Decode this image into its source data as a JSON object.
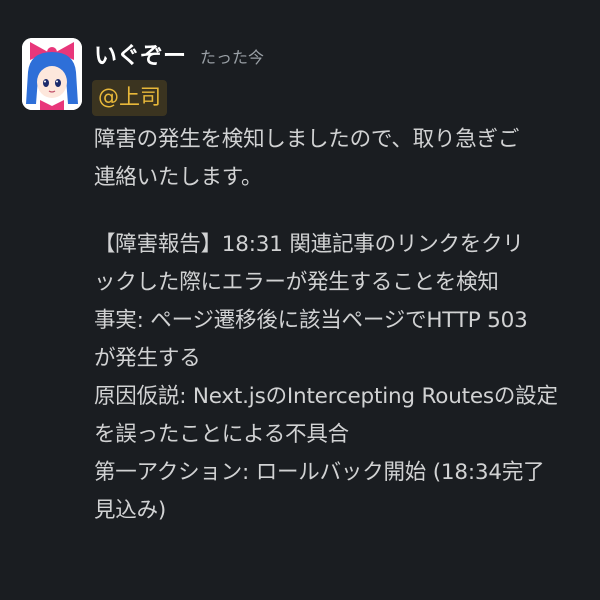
{
  "message": {
    "author": "いぐぞー",
    "timestamp": "たった今",
    "mention": "@上司",
    "intro_lines": [
      "障害の発生を検知しましたので、取り急ぎご",
      "連絡いたします。"
    ],
    "report_lines": [
      "【障害報告】18:31  関連記事のリンクをクリ",
      "ックした際にエラーが発生することを検知",
      "事実: ページ遷移後に該当ページでHTTP 503",
      "が発生する",
      "原因仮説: Next.jsのIntercepting Routesの設定",
      "を誤ったことによる不具合",
      "第一アクション: ロールバック開始 (18:34完了",
      "見込み)"
    ]
  },
  "colors": {
    "background": "#1a1d21",
    "username": "#ffffff",
    "text": "#d1d2d3",
    "timestamp": "#9aa0a6",
    "mention_bg": "#3b3420",
    "mention_text": "#e8b83a"
  },
  "icons": {
    "avatar": "anime-girl-avatar-icon"
  }
}
